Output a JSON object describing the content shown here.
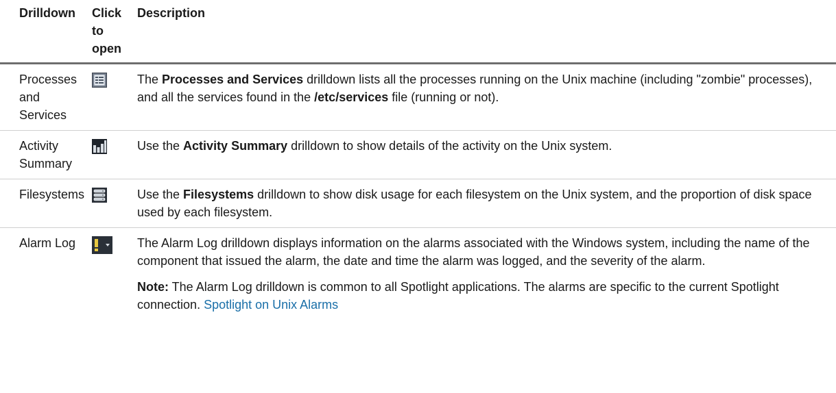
{
  "headers": {
    "drilldown": "Drilldown",
    "click_to_open": "Click to open",
    "description": "Description"
  },
  "rows": [
    {
      "name": "Processes and Services",
      "icon": "list-window-icon",
      "desc_before": "The ",
      "desc_bold": "Processes and Services",
      "desc_mid": " drilldown lists all the processes running on the Unix machine (including \"zombie\" processes), and all the services found in the ",
      "desc_bold2": "/etc/services",
      "desc_after": " file (running or not)."
    },
    {
      "name": "Activity Summary",
      "icon": "bar-chart-icon",
      "desc_before": "Use the ",
      "desc_bold": "Activity Summary",
      "desc_after": " drilldown to show details of the activity on the Unix system."
    },
    {
      "name": "Filesystems",
      "icon": "disk-stack-icon",
      "desc_before": "Use the ",
      "desc_bold": "Filesystems",
      "desc_after": " drilldown to show disk usage for each filesystem on the Unix system, and the proportion of disk space used by each filesystem."
    },
    {
      "name": "Alarm Log",
      "icon": "alarm-dropdown-icon",
      "desc_text": "The Alarm Log drilldown displays information on the alarms associated with the Windows system, including the name of the component that issued the alarm, the date and time the alarm was logged, and the severity of the alarm.",
      "note_label": "Note:",
      "note_text": " The Alarm Log drilldown is common to all Spotlight applications. The alarms are specific to the current Spotlight connection. ",
      "note_link": "Spotlight on Unix Alarms"
    }
  ],
  "colors": {
    "link": "#1a6fa8",
    "header_rule": "#6e6e6e",
    "row_rule": "#cfcfcf"
  }
}
